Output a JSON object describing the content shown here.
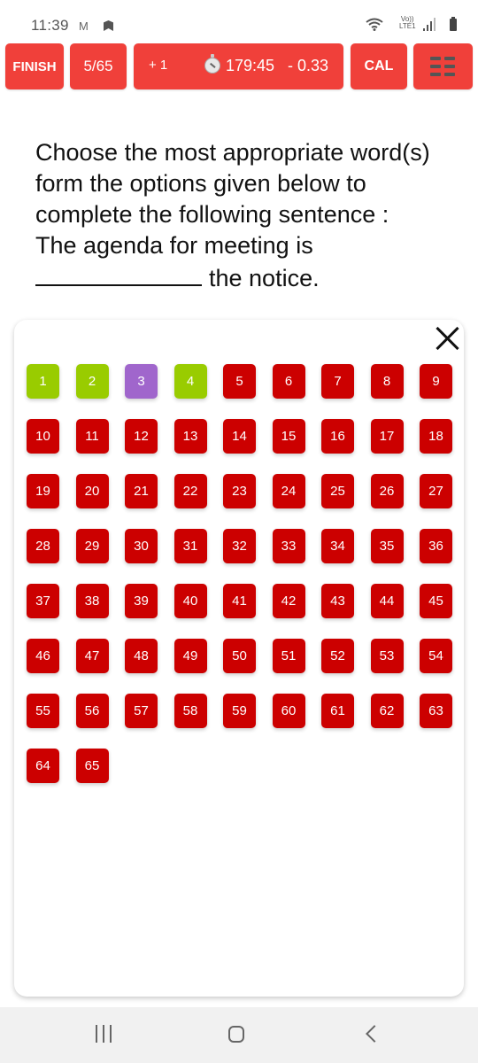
{
  "status_bar": {
    "time": "11:39",
    "gmail_icon": "M",
    "volte_line1": "Vo))",
    "volte_line2": "LTE1",
    "icons": [
      "gmail-icon",
      "navigation-icon",
      "wifi-icon",
      "volte-icon",
      "signal-icon",
      "battery-icon"
    ]
  },
  "toolbar": {
    "finish_label": "FINISH",
    "question_counter": "5/65",
    "positive_marks": "+ 1",
    "timer": "179:45",
    "negative_marks": "- 0.33",
    "cal_label": "CAL",
    "menu_icon": "grid-menu-icon"
  },
  "question": {
    "lines": [
      "Choose the most appropriate word(s)",
      "form the options given below to",
      "complete the following sentence :",
      "The agenda for meeting is"
    ],
    "blank_suffix": "the notice."
  },
  "palette": {
    "close_icon": "close-icon",
    "status_colors": {
      "answered": "#99cc00",
      "marked": "#a066cc",
      "not_answered": "#cc0000"
    },
    "questions": [
      {
        "n": "1",
        "status": "answered"
      },
      {
        "n": "2",
        "status": "answered"
      },
      {
        "n": "3",
        "status": "marked"
      },
      {
        "n": "4",
        "status": "answered"
      },
      {
        "n": "5",
        "status": "not_answered"
      },
      {
        "n": "6",
        "status": "not_answered"
      },
      {
        "n": "7",
        "status": "not_answered"
      },
      {
        "n": "8",
        "status": "not_answered"
      },
      {
        "n": "9",
        "status": "not_answered"
      },
      {
        "n": "10",
        "status": "not_answered"
      },
      {
        "n": "11",
        "status": "not_answered"
      },
      {
        "n": "12",
        "status": "not_answered"
      },
      {
        "n": "13",
        "status": "not_answered"
      },
      {
        "n": "14",
        "status": "not_answered"
      },
      {
        "n": "15",
        "status": "not_answered"
      },
      {
        "n": "16",
        "status": "not_answered"
      },
      {
        "n": "17",
        "status": "not_answered"
      },
      {
        "n": "18",
        "status": "not_answered"
      },
      {
        "n": "19",
        "status": "not_answered"
      },
      {
        "n": "20",
        "status": "not_answered"
      },
      {
        "n": "21",
        "status": "not_answered"
      },
      {
        "n": "22",
        "status": "not_answered"
      },
      {
        "n": "23",
        "status": "not_answered"
      },
      {
        "n": "24",
        "status": "not_answered"
      },
      {
        "n": "25",
        "status": "not_answered"
      },
      {
        "n": "26",
        "status": "not_answered"
      },
      {
        "n": "27",
        "status": "not_answered"
      },
      {
        "n": "28",
        "status": "not_answered"
      },
      {
        "n": "29",
        "status": "not_answered"
      },
      {
        "n": "30",
        "status": "not_answered"
      },
      {
        "n": "31",
        "status": "not_answered"
      },
      {
        "n": "32",
        "status": "not_answered"
      },
      {
        "n": "33",
        "status": "not_answered"
      },
      {
        "n": "34",
        "status": "not_answered"
      },
      {
        "n": "35",
        "status": "not_answered"
      },
      {
        "n": "36",
        "status": "not_answered"
      },
      {
        "n": "37",
        "status": "not_answered"
      },
      {
        "n": "38",
        "status": "not_answered"
      },
      {
        "n": "39",
        "status": "not_answered"
      },
      {
        "n": "40",
        "status": "not_answered"
      },
      {
        "n": "41",
        "status": "not_answered"
      },
      {
        "n": "42",
        "status": "not_answered"
      },
      {
        "n": "43",
        "status": "not_answered"
      },
      {
        "n": "44",
        "status": "not_answered"
      },
      {
        "n": "45",
        "status": "not_answered"
      },
      {
        "n": "46",
        "status": "not_answered"
      },
      {
        "n": "47",
        "status": "not_answered"
      },
      {
        "n": "48",
        "status": "not_answered"
      },
      {
        "n": "49",
        "status": "not_answered"
      },
      {
        "n": "50",
        "status": "not_answered"
      },
      {
        "n": "51",
        "status": "not_answered"
      },
      {
        "n": "52",
        "status": "not_answered"
      },
      {
        "n": "53",
        "status": "not_answered"
      },
      {
        "n": "54",
        "status": "not_answered"
      },
      {
        "n": "55",
        "status": "not_answered"
      },
      {
        "n": "56",
        "status": "not_answered"
      },
      {
        "n": "57",
        "status": "not_answered"
      },
      {
        "n": "58",
        "status": "not_answered"
      },
      {
        "n": "59",
        "status": "not_answered"
      },
      {
        "n": "60",
        "status": "not_answered"
      },
      {
        "n": "61",
        "status": "not_answered"
      },
      {
        "n": "62",
        "status": "not_answered"
      },
      {
        "n": "63",
        "status": "not_answered"
      },
      {
        "n": "64",
        "status": "not_answered"
      },
      {
        "n": "65",
        "status": "not_answered"
      }
    ]
  },
  "nav_bar": {
    "icons": [
      "recents-icon",
      "home-icon",
      "back-icon"
    ]
  }
}
